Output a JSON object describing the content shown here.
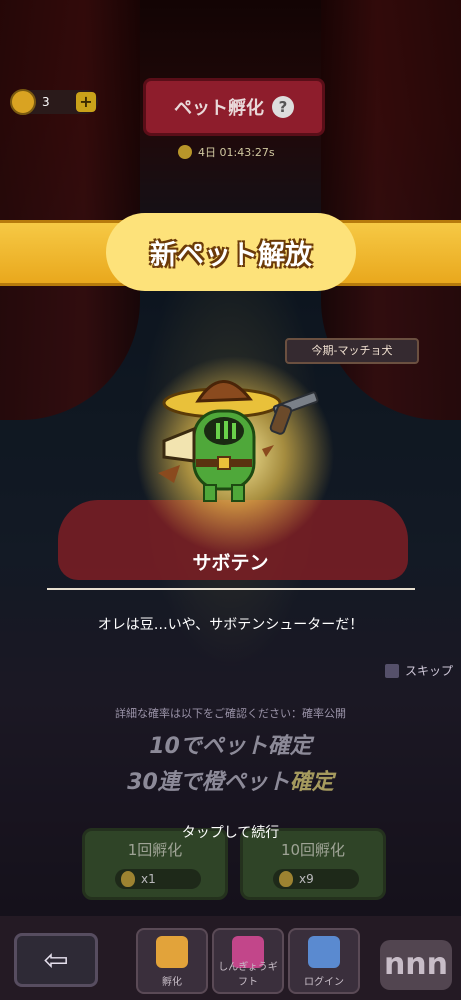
{
  "hud": {
    "currency_value": "3",
    "add_button": "+",
    "screen_title": "ペット孵化",
    "help_label": "?",
    "timer": "4日 01:43:27s"
  },
  "banner": {
    "title": "新ペット解放"
  },
  "season": {
    "label": "今期-マッチョ犬"
  },
  "pet": {
    "name": "サボテン",
    "quote": "オレは豆…いや、サボテンシューターだ！"
  },
  "skip": {
    "label": "スキップ"
  },
  "info": {
    "rates_text": "詳細な確率は以下をご確認ください：確率公開",
    "confirm_line1": "10でペット確定",
    "confirm_line2_a": "30連で橙ペット",
    "confirm_line2_b": "確定"
  },
  "prompt": {
    "tap_to_continue": "タップして続行"
  },
  "hatch_buttons": [
    {
      "label": "1回孵化",
      "cost": "x1"
    },
    {
      "label": "10回孵化",
      "cost": "x9"
    }
  ],
  "nav": {
    "back_glyph": "⇦",
    "tabs": [
      {
        "label": "孵化",
        "icon": "egg-icon",
        "color": "#e2a33a"
      },
      {
        "label": "しんぎょうギフト",
        "icon": "gift-icon",
        "color": "#c2468a"
      },
      {
        "label": "ログイン",
        "icon": "calendar-icon",
        "color": "#5a8ad0"
      }
    ]
  },
  "watermark": {
    "text": "nnn"
  },
  "colors": {
    "banner_gold": "#f6c945",
    "title_red": "#8e1d2c",
    "pet_green": "#4fa83a"
  }
}
